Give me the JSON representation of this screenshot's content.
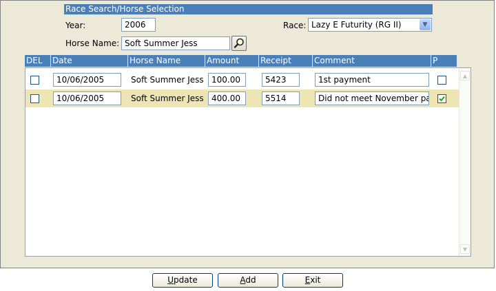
{
  "form": {
    "section_title": "Race Search/Horse Selection",
    "year_label": "Year:",
    "year_value": "2006",
    "race_label": "Race:",
    "race_value": "Lazy E Futurity (RG II)",
    "horse_name_label": "Horse Name:",
    "horse_name_value": "Soft Summer Jess"
  },
  "grid": {
    "columns": [
      "DEL",
      "Date",
      "Horse Name",
      "Amount",
      "Receipt",
      "Comment",
      "P"
    ],
    "rows": [
      {
        "del": false,
        "date": "10/06/2005",
        "horse_name": "Soft Summer Jess",
        "amount": "100.00",
        "receipt": "5423",
        "comment": "1st payment",
        "paid": false
      },
      {
        "del": false,
        "date": "10/06/2005",
        "horse_name": "Soft Summer Jess",
        "amount": "400.00",
        "receipt": "5514",
        "comment": "Did not meet November paym",
        "paid": true
      }
    ]
  },
  "buttons": {
    "update_first": "U",
    "update_rest": "pdate",
    "add_first": "A",
    "add_rest": "dd",
    "exit_first": "E",
    "exit_rest": "xit"
  },
  "icons": {
    "search": "search-icon",
    "dropdown": "chevron-down-icon",
    "scroll_up": "chevron-up-icon",
    "scroll_down": "chevron-down-icon",
    "check": "check-icon"
  }
}
